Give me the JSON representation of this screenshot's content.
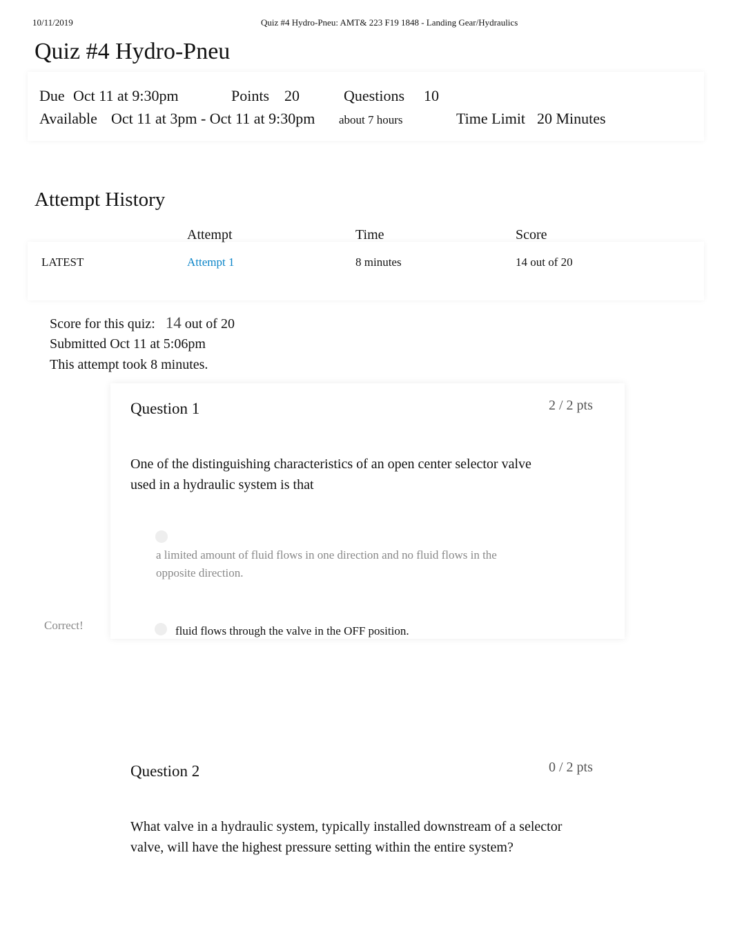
{
  "print_header": {
    "date": "10/11/2019",
    "doc_title": "Quiz #4 Hydro-Pneu: AMT& 223 F19 1848 - Landing Gear/Hydraulics"
  },
  "quiz": {
    "title": "Quiz #4 Hydro-Pneu",
    "due_label": "Due",
    "due": "Oct 11 at 9:30pm",
    "points_label": "Points",
    "points": "20",
    "questions_label": "Questions",
    "questions": "10",
    "available_label": "Available",
    "available": "Oct 11 at 3pm - Oct 11 at 9:30pm",
    "available_duration": "about 7 hours",
    "time_limit_label": "Time Limit",
    "time_limit": "20 Minutes"
  },
  "history": {
    "title": "Attempt History",
    "columns": [
      "Attempt",
      "Time",
      "Score"
    ],
    "row": {
      "status": "LATEST",
      "attempt": "Attempt 1",
      "time": "8 minutes",
      "score": "14 out of 20"
    }
  },
  "summary": {
    "score_label": "Score for this quiz:",
    "score": "14",
    "score_suffix": "out of 20",
    "submitted": "Submitted Oct 11 at 5:06pm",
    "duration": "This attempt took 8 minutes."
  },
  "questions": [
    {
      "title": "Question 1",
      "pts": "2 / 2 pts",
      "text": "One of the distinguishing characteristics of an open center selector valve used in a hydraulic system is that",
      "answers": [
        "a limited amount of fluid flows in one direction and no fluid flows in the opposite direction.",
        "fluid flows through the valve in the OFF position."
      ],
      "feedback": "Correct!"
    },
    {
      "title": "Question 2",
      "pts": "0 / 2 pts",
      "text": "What valve in a hydraulic system, typically installed downstream of a selector valve, will have the highest pressure setting within the entire system?"
    }
  ]
}
